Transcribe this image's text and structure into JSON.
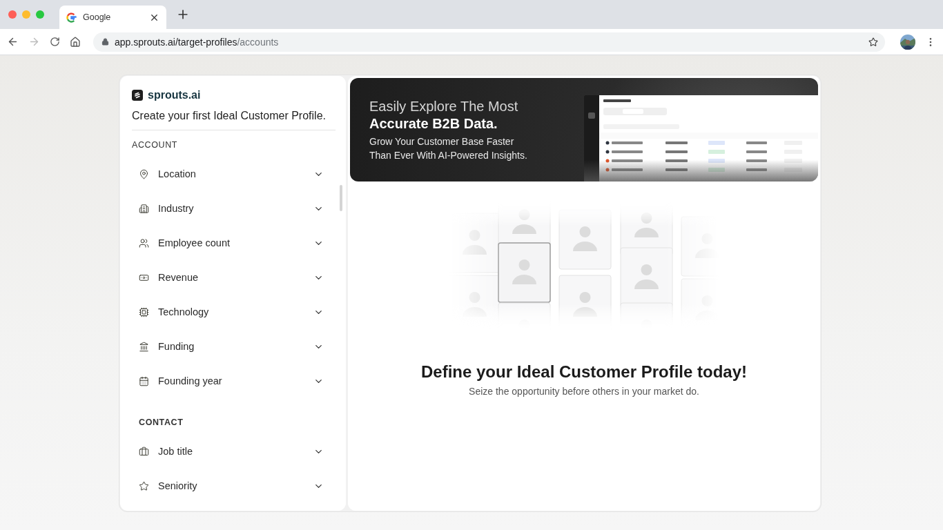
{
  "browser": {
    "tab": {
      "title": "Google"
    },
    "address": {
      "main": "app.sprouts.ai/target-profiles",
      "rest": "/accounts"
    }
  },
  "sidebar": {
    "brand": "sprouts.ai",
    "tagline": "Create your first Ideal Customer Profile.",
    "sections": [
      {
        "heading": "ACCOUNT",
        "items": [
          {
            "kind": "location",
            "label": "Location",
            "expanded": false
          },
          {
            "kind": "industry",
            "label": "Industry",
            "expanded": false
          },
          {
            "kind": "employees",
            "label": "Employee count",
            "expanded": false
          },
          {
            "kind": "revenue",
            "label": "Revenue",
            "expanded": false
          },
          {
            "kind": "technology",
            "label": "Technology",
            "expanded": false
          },
          {
            "kind": "funding",
            "label": "Funding",
            "expanded": false
          },
          {
            "kind": "calendar",
            "label": "Founding year",
            "expanded": false
          }
        ]
      },
      {
        "heading": "CONTACT",
        "items": [
          {
            "kind": "job",
            "label": "Job title",
            "expanded": false
          },
          {
            "kind": "seniority",
            "label": "Seniority",
            "expanded": false
          }
        ]
      }
    ]
  },
  "banner": {
    "line1": "Easily Explore The Most",
    "line2": "Accurate B2B Data.",
    "line3": "Grow Your Customer Base Faster",
    "line4": "Than Ever With AI-Powered Insights."
  },
  "empty_state": {
    "title": "Define your Ideal Customer Profile today!",
    "subtitle": "Seize the opportunity before others in your market do."
  }
}
